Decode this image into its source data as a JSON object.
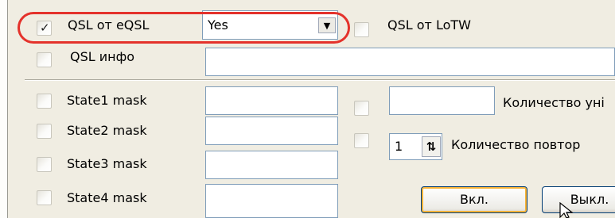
{
  "qsl_eqsl": {
    "label": "QSL от eQSL",
    "checked": true,
    "value": "Yes"
  },
  "qsl_lotw": {
    "label": "QSL от LoTW",
    "checked": false
  },
  "qsl_info": {
    "label": "QSL инфо",
    "checked": false,
    "value": ""
  },
  "states": [
    {
      "label": "State1 mask",
      "checked": false,
      "value": ""
    },
    {
      "label": "State2 mask",
      "checked": false,
      "value": ""
    },
    {
      "label": "State3 mask",
      "checked": false,
      "value": ""
    },
    {
      "label": "State4 mask",
      "checked": false,
      "value": ""
    }
  ],
  "right": {
    "count_unique": {
      "label": "Количество уні",
      "checked": false,
      "value": ""
    },
    "count_repeat": {
      "label": "Количество повтор",
      "checked": false,
      "value": "1"
    }
  },
  "buttons": {
    "on": "Вкл.",
    "off": "Выкл."
  },
  "colors": {
    "highlight": "#e4322b",
    "panel": "#f0ede2"
  },
  "icons": {
    "check": "checkmark-icon",
    "dropdown": "chevron-down-icon",
    "spin": "spin-arrows-icon",
    "cursor": "mouse-cursor-icon"
  }
}
